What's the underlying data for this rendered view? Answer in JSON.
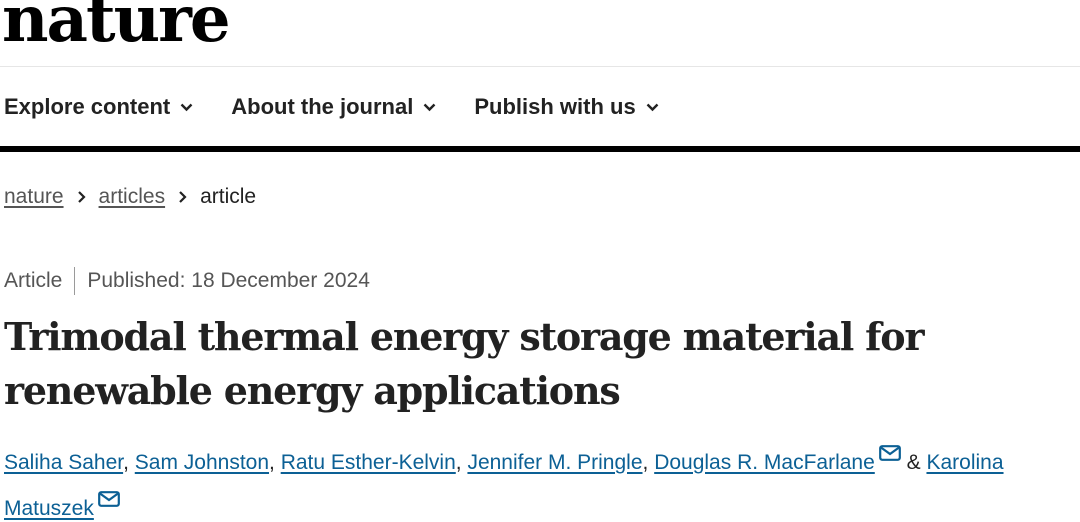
{
  "site": {
    "logo_text": "nature"
  },
  "nav": {
    "items": [
      {
        "label": "Explore content"
      },
      {
        "label": "About the journal"
      },
      {
        "label": "Publish with us"
      }
    ]
  },
  "breadcrumb": {
    "items": [
      {
        "label": "nature"
      },
      {
        "label": "articles"
      },
      {
        "label": "article"
      }
    ]
  },
  "article": {
    "type": "Article",
    "published": "Published: 18 December 2024",
    "title": "Trimodal thermal energy storage material for renewable energy applications",
    "authors": [
      {
        "name": "Saliha Saher",
        "sep": ", "
      },
      {
        "name": "Sam Johnston",
        "sep": ", "
      },
      {
        "name": "Ratu Esther-Kelvin",
        "sep": ", "
      },
      {
        "name": "Jennifer M. Pringle",
        "sep": ", "
      },
      {
        "name": "Douglas R. MacFarlane",
        "sep": " & "
      },
      {
        "name": "Karolina Matuszek",
        "sep": ""
      }
    ]
  },
  "colors": {
    "link": "#0c6095",
    "text": "#222222",
    "muted": "#555555"
  },
  "icons": {
    "chevron": "chevron-down-icon",
    "mail": "mail-icon",
    "separator": "chevron-right-icon"
  }
}
